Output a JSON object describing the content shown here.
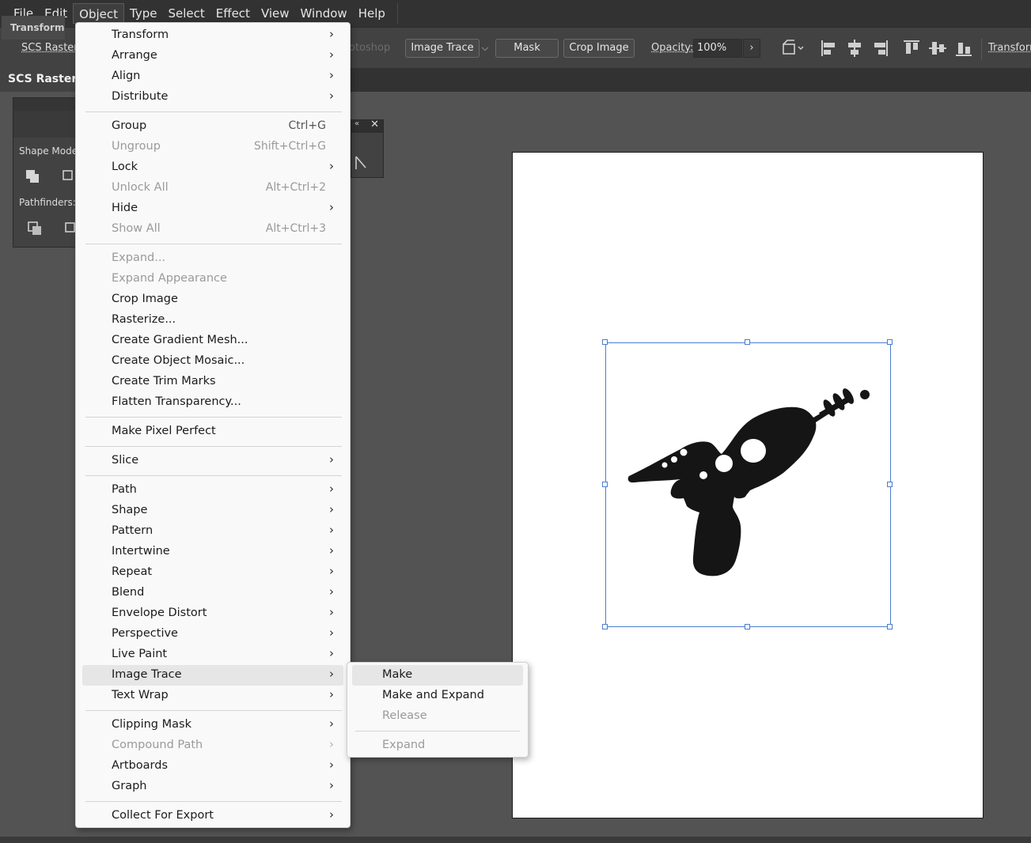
{
  "menubar": {
    "items": [
      "File",
      "Edit",
      "Object",
      "Type",
      "Select",
      "Effect",
      "View",
      "Window",
      "Help"
    ],
    "active": "Object"
  },
  "controlbar": {
    "doc_label": "SCS Raster E",
    "ghost_label": "otoshop",
    "image_trace_label": "Image Trace",
    "mask_label": "Mask",
    "crop_image_label": "Crop Image",
    "opacity_label": "Opacity:",
    "opacity_value": "100%",
    "transform_label": "Transform"
  },
  "tabbar": {
    "doc_tab": "SCS Raster Ex"
  },
  "pathfinder_panel": {
    "tab_label": "Transform",
    "shape_modes_label": "Shape Modes",
    "pathfinders_label": "Pathfinders:"
  },
  "object_menu": {
    "items": [
      {
        "label": "Transform",
        "shortcut": "",
        "submenu": true,
        "disabled": false
      },
      {
        "label": "Arrange",
        "shortcut": "",
        "submenu": true,
        "disabled": false
      },
      {
        "label": "Align",
        "shortcut": "",
        "submenu": true,
        "disabled": false
      },
      {
        "label": "Distribute",
        "shortcut": "",
        "submenu": true,
        "disabled": false
      },
      {
        "label": "Group",
        "shortcut": "Ctrl+G",
        "submenu": false,
        "disabled": false
      },
      {
        "label": "Ungroup",
        "shortcut": "Shift+Ctrl+G",
        "submenu": false,
        "disabled": true
      },
      {
        "label": "Lock",
        "shortcut": "",
        "submenu": true,
        "disabled": false
      },
      {
        "label": "Unlock All",
        "shortcut": "Alt+Ctrl+2",
        "submenu": false,
        "disabled": true
      },
      {
        "label": "Hide",
        "shortcut": "",
        "submenu": true,
        "disabled": false
      },
      {
        "label": "Show All",
        "shortcut": "Alt+Ctrl+3",
        "submenu": false,
        "disabled": true
      },
      {
        "label": "Expand...",
        "shortcut": "",
        "submenu": false,
        "disabled": true
      },
      {
        "label": "Expand Appearance",
        "shortcut": "",
        "submenu": false,
        "disabled": true
      },
      {
        "label": "Crop Image",
        "shortcut": "",
        "submenu": false,
        "disabled": false
      },
      {
        "label": "Rasterize...",
        "shortcut": "",
        "submenu": false,
        "disabled": false
      },
      {
        "label": "Create Gradient Mesh...",
        "shortcut": "",
        "submenu": false,
        "disabled": false
      },
      {
        "label": "Create Object Mosaic...",
        "shortcut": "",
        "submenu": false,
        "disabled": false
      },
      {
        "label": "Create Trim Marks",
        "shortcut": "",
        "submenu": false,
        "disabled": false
      },
      {
        "label": "Flatten Transparency...",
        "shortcut": "",
        "submenu": false,
        "disabled": false
      },
      {
        "label": "Make Pixel Perfect",
        "shortcut": "",
        "submenu": false,
        "disabled": false
      },
      {
        "label": "Slice",
        "shortcut": "",
        "submenu": true,
        "disabled": false
      },
      {
        "label": "Path",
        "shortcut": "",
        "submenu": true,
        "disabled": false
      },
      {
        "label": "Shape",
        "shortcut": "",
        "submenu": true,
        "disabled": false
      },
      {
        "label": "Pattern",
        "shortcut": "",
        "submenu": true,
        "disabled": false
      },
      {
        "label": "Intertwine",
        "shortcut": "",
        "submenu": true,
        "disabled": false
      },
      {
        "label": "Repeat",
        "shortcut": "",
        "submenu": true,
        "disabled": false
      },
      {
        "label": "Blend",
        "shortcut": "",
        "submenu": true,
        "disabled": false
      },
      {
        "label": "Envelope Distort",
        "shortcut": "",
        "submenu": true,
        "disabled": false
      },
      {
        "label": "Perspective",
        "shortcut": "",
        "submenu": true,
        "disabled": false
      },
      {
        "label": "Live Paint",
        "shortcut": "",
        "submenu": true,
        "disabled": false
      },
      {
        "label": "Image Trace",
        "shortcut": "",
        "submenu": true,
        "disabled": false,
        "highlighted": true
      },
      {
        "label": "Text Wrap",
        "shortcut": "",
        "submenu": true,
        "disabled": false
      },
      {
        "label": "Clipping Mask",
        "shortcut": "",
        "submenu": true,
        "disabled": false
      },
      {
        "label": "Compound Path",
        "shortcut": "",
        "submenu": true,
        "disabled": true
      },
      {
        "label": "Artboards",
        "shortcut": "",
        "submenu": true,
        "disabled": false
      },
      {
        "label": "Graph",
        "shortcut": "",
        "submenu": true,
        "disabled": false
      },
      {
        "label": "Collect For Export",
        "shortcut": "",
        "submenu": true,
        "disabled": false
      }
    ]
  },
  "image_trace_submenu": {
    "items": [
      {
        "label": "Make",
        "disabled": false,
        "highlighted": true
      },
      {
        "label": "Make and Expand",
        "disabled": false
      },
      {
        "label": "Release",
        "disabled": true
      },
      {
        "label": "Expand",
        "disabled": true
      }
    ]
  },
  "colors": {
    "selection_accent": "#4a7ccf",
    "artwork_fill": "#151515"
  }
}
